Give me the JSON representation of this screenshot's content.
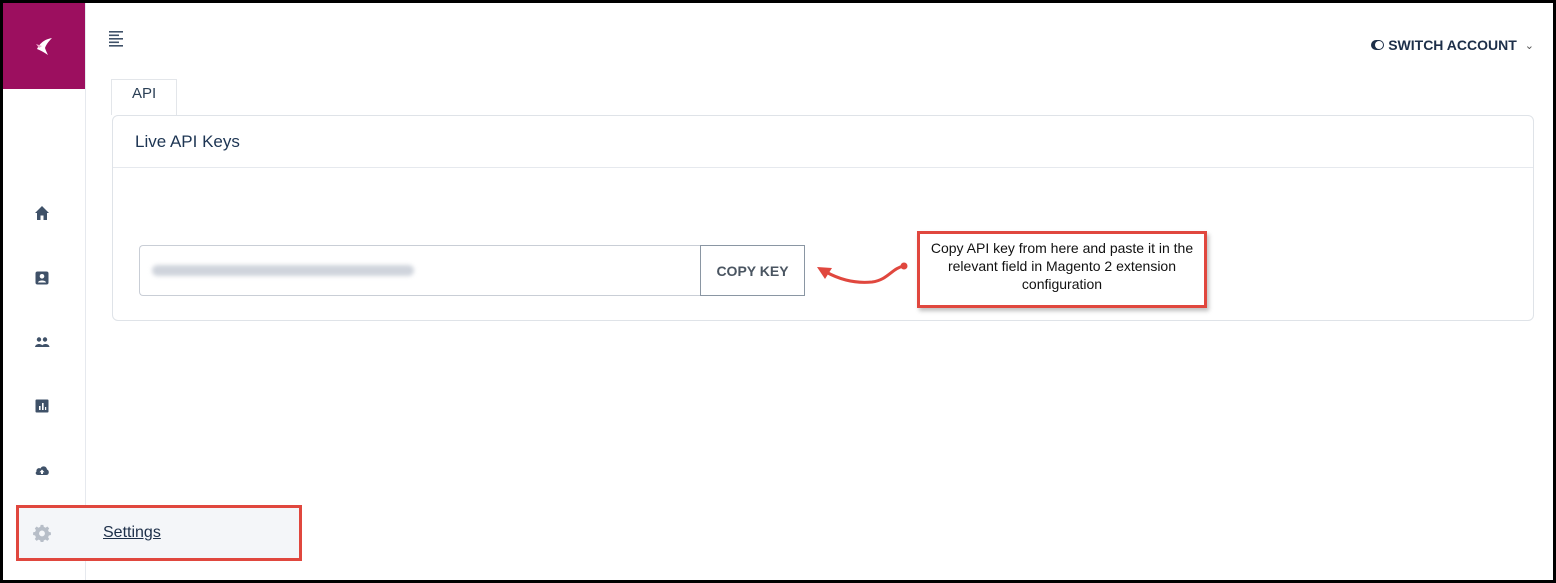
{
  "header": {
    "switch_account_label": "SWITCH ACCOUNT",
    "switch_account_chevron": "⌄"
  },
  "sidebar": {
    "brand_color": "#9c0f5f",
    "nav_icons": [
      "home-icon",
      "contact-card-icon",
      "users-icon",
      "report-icon",
      "cloud-upload-icon"
    ],
    "settings_label": "Settings"
  },
  "tabs": [
    {
      "label": "API"
    }
  ],
  "card": {
    "title": "Live API Keys",
    "copy_button_label": "COPY KEY"
  },
  "annotation": {
    "text": "Copy API key from here and paste it in the relevant field in Magento 2 extension configuration",
    "color": "#e0473e"
  }
}
